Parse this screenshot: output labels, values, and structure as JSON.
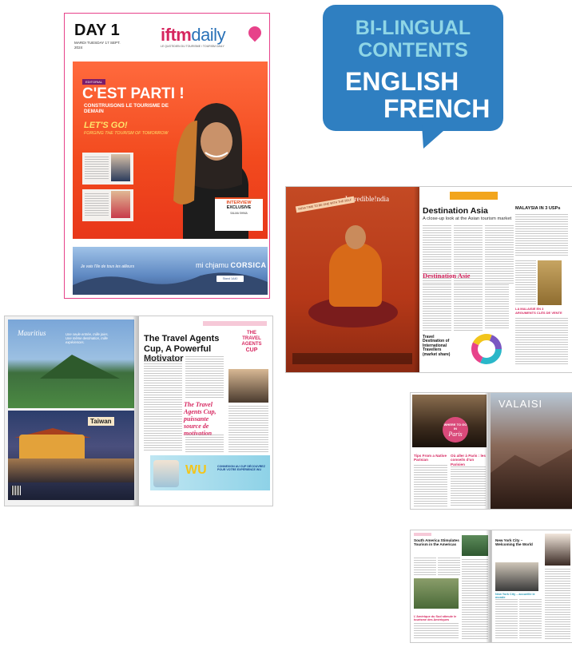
{
  "bubble": {
    "line1": "BI-LINGUAL",
    "line2": "CONTENTS",
    "english": "ENGLISH",
    "french": "FRENCH"
  },
  "cover": {
    "day": "DAY 1",
    "date": "MARDI TUESDAY 17 SEPT. 2024",
    "logo_main": "iftm",
    "logo_sub": "daily",
    "tagline": "LE QUOTIDIEN DU TOURISME / TOURISM DAILY",
    "badge": "EDITORIAL",
    "headline": "C'EST PARTI !",
    "subhead": "CONSTRUISONS LE TOURISME DE DEMAIN",
    "letsgo": "LET'S GO!",
    "letsgo_sub": "FORGING THE TOURISM OF TOMORROW",
    "interview_line1": "INTERVIEW",
    "interview_line2": "EXCLUSIVE",
    "interview_name": "SALMA SHIMA",
    "ad_left": "Je vais l'île de tous les ailleurs",
    "ad_mi": "mi chjamu",
    "ad_brand": "CORSICA",
    "ad_button": "Stand 1A40"
  },
  "asia": {
    "logo": "Incredible!ndia",
    "tag": "INDIA TIME TO BE ONE WITH THE SELF",
    "title": "Destination Asia",
    "subtitle": "A close-up look at the Asian tourism market",
    "title_fr": "Destination Asie",
    "chart_title": "Travel Destination of International Travellers (market share)",
    "sidebar_title": "MALAYSIA IN 3 USPs",
    "pink_heading": "LA MALAISIE EN 3 ARGUMENTS CLÉS DE VENTE"
  },
  "tac": {
    "mauritius_logo": "Mauritius",
    "mauritius_line": "Une seule entrée, mille joies. Une même destination, mille expériences.",
    "taiwan_logo": "Taiwan",
    "title": "The Travel Agents Cup, A Powerful Motivator",
    "badge_line1": "THE",
    "badge_line2": "TRAVEL AGENTS",
    "badge_line3": "CUP",
    "pink_fr": "The Travel Agents Cup, puissante source de motivation",
    "banner_brand": "WU",
    "banner_text": "CONNEXION AU CUP DÉCOUVREZ POUR VOTRE EXPÉRIENCE WU"
  },
  "paris": {
    "circle_top": "WHERE TO GO IN",
    "circle_city": "Paris",
    "heading1": "Tips From a Native Parisian",
    "heading2": "Où aller à Paris : les conseils d'un Parisien",
    "right_title": "VALAISI"
  },
  "sa": {
    "title": "South America Stimulates Tourism in the Americas",
    "pink": "L'Amérique du Sud stimule le tourisme des Amériques",
    "nyc_title": "New York City – Welcoming the World",
    "pink2": "New York City – accueille le monde"
  }
}
